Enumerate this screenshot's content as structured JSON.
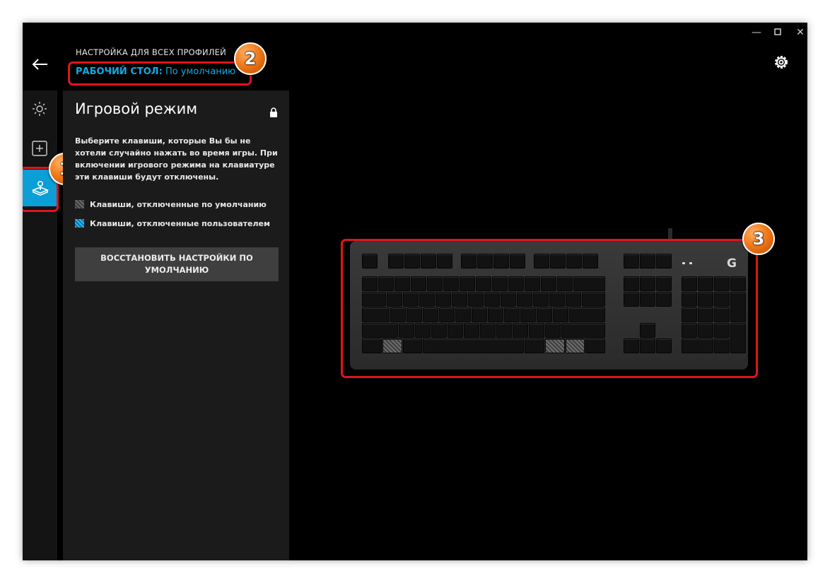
{
  "header": {
    "title": "НАСТРОЙКА ДЛЯ ВСЕХ ПРОФИЛЕЙ",
    "profile_label": "РАБОЧИЙ СТОЛ:",
    "profile_value": "По умолчанию"
  },
  "window_controls": [
    "minimize-icon",
    "maximize-icon",
    "close-icon"
  ],
  "sidebar": {
    "items": [
      {
        "icon": "lighting-icon",
        "active": false
      },
      {
        "icon": "assignments-plus-icon",
        "active": false
      },
      {
        "icon": "game-mode-joystick-icon",
        "active": true
      }
    ]
  },
  "panel": {
    "title": "Игровой режим",
    "description": "Выберите клавиши, которые Вы бы не хотели случайно нажать во время игры. При включении игрового режима на клавиатуре эти клавиши будут отключены.",
    "legend": [
      {
        "label": "Клавиши, отключенные по умолчанию",
        "color": "#5a5a5a"
      },
      {
        "label": "Клавиши, отключенные пользователем",
        "color": "#29b6f0"
      }
    ],
    "restore_button": "ВОССТАНОВИТЬ НАСТРОЙКИ ПО УМОЛЧАНИЮ"
  },
  "keyboard": {
    "logo": "G"
  },
  "annotations": {
    "badge1": "1",
    "badge2": "2",
    "badge3": "3"
  },
  "colors": {
    "accent": "#0c9ed6",
    "profile_text": "#16a9e2",
    "annotation_red": "#e0141c",
    "annotation_badge": "#f07a1a"
  }
}
